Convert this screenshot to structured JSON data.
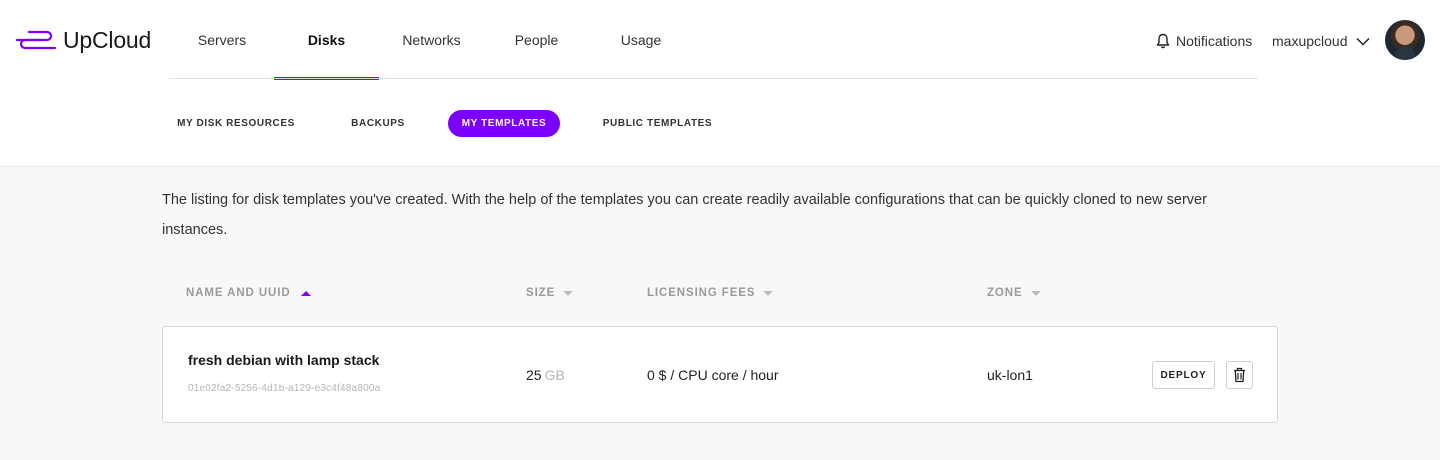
{
  "brand": {
    "name": "UpCloud",
    "accent": "#7b00ff"
  },
  "nav": {
    "items": [
      {
        "label": "Servers",
        "active": false
      },
      {
        "label": "Disks",
        "active": true
      },
      {
        "label": "Networks",
        "active": false
      },
      {
        "label": "People",
        "active": false
      },
      {
        "label": "Usage",
        "active": false
      }
    ]
  },
  "header": {
    "notifications_label": "Notifications",
    "notifications_icon": "bell-icon",
    "username": "maxupcloud",
    "user_menu_icon": "chevron-down-icon"
  },
  "subtabs": [
    {
      "label": "MY DISK RESOURCES",
      "active": false
    },
    {
      "label": "BACKUPS",
      "active": false
    },
    {
      "label": "MY TEMPLATES",
      "active": true
    },
    {
      "label": "PUBLIC TEMPLATES",
      "active": false
    }
  ],
  "description": "The listing for disk templates you've created. With the help of the templates you can create readily available configurations that can be quickly cloned to new server instances.",
  "table": {
    "columns": [
      {
        "label": "NAME AND UUID",
        "sort": "asc"
      },
      {
        "label": "SIZE",
        "sort": "none"
      },
      {
        "label": "LICENSING FEES",
        "sort": "none"
      },
      {
        "label": "ZONE",
        "sort": "none"
      }
    ],
    "rows": [
      {
        "name": "fresh debian with lamp stack",
        "uuid": "01e02fa2-5256-4d1b-a129-e3c4f48a800a",
        "size_value": "25",
        "size_unit": "GB",
        "fees": "0 $ / CPU core / hour",
        "zone": "uk-lon1",
        "deploy_label": "DEPLOY",
        "delete_icon": "trash-icon"
      }
    ]
  }
}
